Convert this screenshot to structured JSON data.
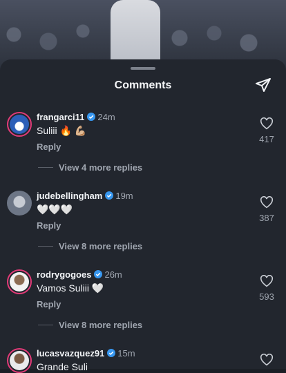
{
  "header": {
    "title": "Comments",
    "send_icon": "send-icon"
  },
  "comments": [
    {
      "username": "frangarci11",
      "time": "24m",
      "text": "Suliii 🔥 💪🏼",
      "reply": "Reply",
      "more_replies": "View 4 more replies",
      "likes": "417",
      "verified": true
    },
    {
      "username": "judebellingham",
      "time": "19m",
      "text": "🤍🤍🤍",
      "reply": "Reply",
      "more_replies": "View 8 more replies",
      "likes": "387",
      "verified": true
    },
    {
      "username": "rodrygogoes",
      "time": "26m",
      "text": "Vamos Suliii 🤍",
      "reply": "Reply",
      "more_replies": "View 8 more replies",
      "likes": "593",
      "verified": true
    },
    {
      "username": "lucasvazquez91",
      "time": "15m",
      "text": "Grande Suli",
      "reply": "",
      "more_replies": "",
      "likes": "",
      "verified": true
    }
  ],
  "colors": {
    "sheet_bg": "#22262e",
    "verified_blue": "#3797f0",
    "muted_text": "#a0a6b0",
    "story_ring": "#e23b78"
  }
}
